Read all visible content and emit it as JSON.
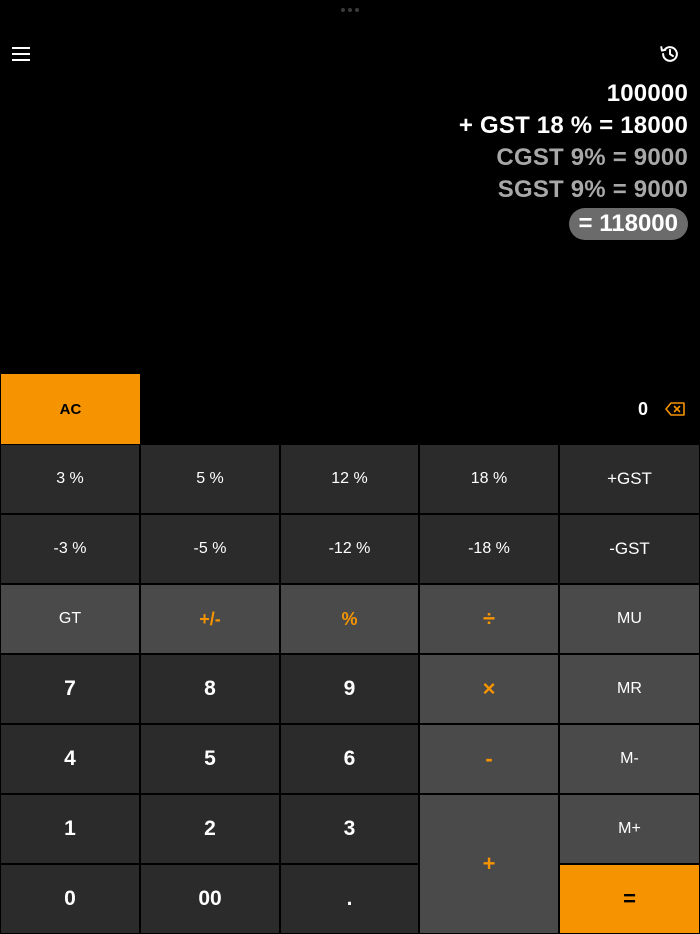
{
  "display": {
    "lines": [
      {
        "text": "100000",
        "tone": "white"
      },
      {
        "text": "+ GST 18 % = 18000",
        "tone": "white"
      },
      {
        "text": "CGST 9% = 9000",
        "tone": "grey"
      },
      {
        "text": "SGST 9% = 9000",
        "tone": "grey"
      }
    ],
    "result": "= 118000"
  },
  "entry": {
    "ac_label": "AC",
    "value": "0"
  },
  "keys": {
    "p3": "3 %",
    "p5": "5 %",
    "p12": "12 %",
    "p18": "18 %",
    "plus_gst": "+GST",
    "m3": "-3 %",
    "m5": "-5 %",
    "m12": "-12 %",
    "m18": "-18 %",
    "minus_gst": "-GST",
    "gt": "GT",
    "sign": "+/-",
    "percent": "%",
    "divide": "÷",
    "mu": "MU",
    "seven": "7",
    "eight": "8",
    "nine": "9",
    "multiply": "×",
    "mr": "MR",
    "four": "4",
    "five": "5",
    "six": "6",
    "minus": "-",
    "m_minus": "M-",
    "one": "1",
    "two": "2",
    "three": "3",
    "plus": "+",
    "m_plus": "M+",
    "zero": "0",
    "double_zero": "00",
    "decimal": ".",
    "equals": "="
  },
  "colors": {
    "accent": "#f59300",
    "key_dark": "#2b2b2b",
    "key_mid": "#4a4a4a",
    "result_pill": "#6b6b6b"
  },
  "icons": {
    "menu": "menu-icon",
    "history": "history-icon",
    "backspace": "backspace-icon"
  }
}
